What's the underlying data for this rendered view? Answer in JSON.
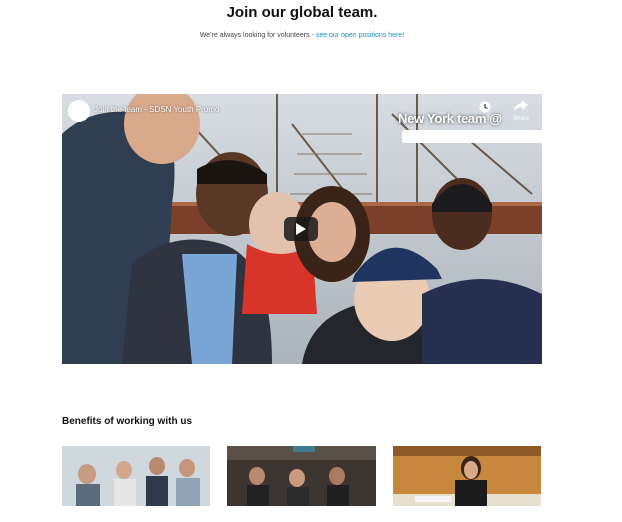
{
  "header": {
    "title": "Join our global team.",
    "subtitle_text": "We're always looking for volunteers - ",
    "subtitle_link": "see our open positions here!"
  },
  "video": {
    "title": "Join the team - SDSN Youth Promo",
    "watch_later_label": "Watch later",
    "share_label": "Share",
    "overlay_text": "New York team @",
    "play_icon": "play-icon",
    "colors": {
      "play_bg": "#1a1a1a"
    }
  },
  "benefits": {
    "heading": "Benefits of working with us"
  },
  "colors": {
    "link": "#1a8fc9",
    "text": "#111111"
  }
}
